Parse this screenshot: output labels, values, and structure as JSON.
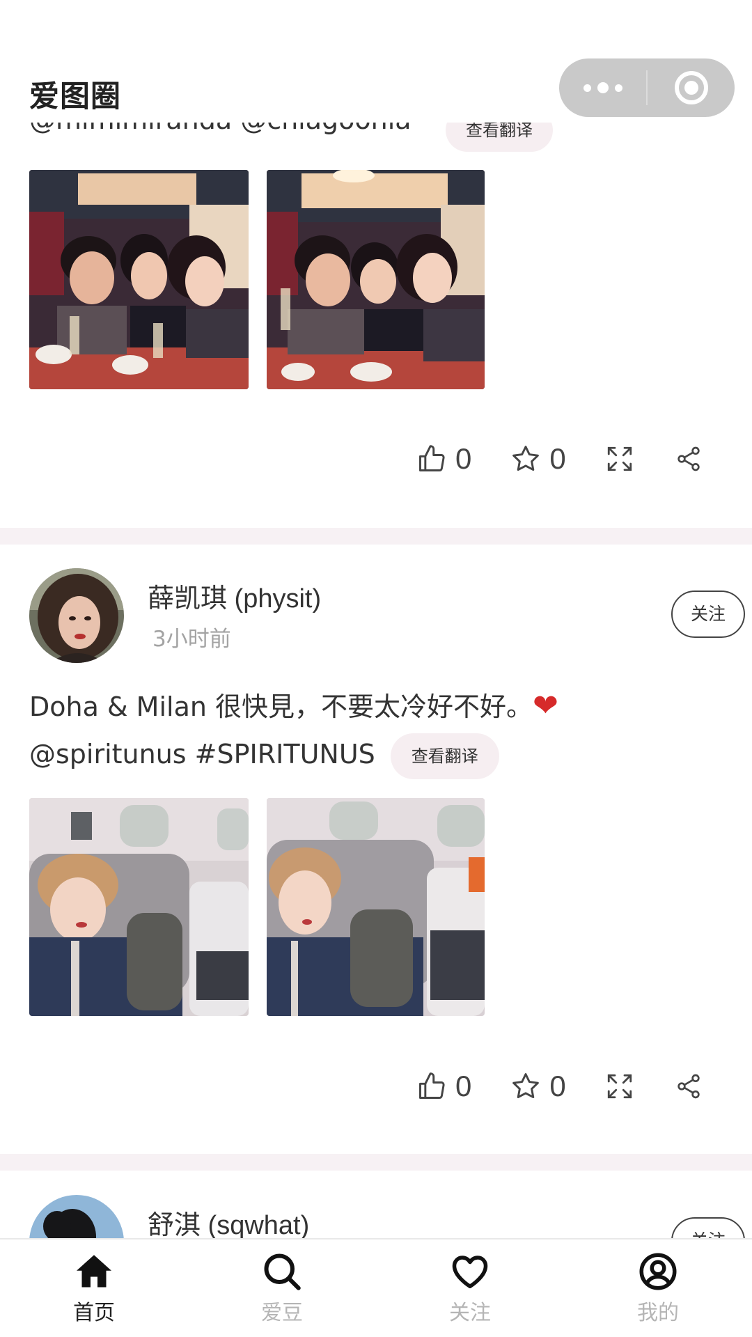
{
  "header": {
    "title": "爱图圈"
  },
  "capsule": {
    "more_icon": "more-dots-icon",
    "close_icon": "target-icon"
  },
  "top_post": {
    "caption_cut": "@mimimiranda @chiagoonla",
    "translate_label": "查看翻译",
    "likes": "0",
    "favorites": "0"
  },
  "post2": {
    "username": "薛凯琪 (physit)",
    "time": "3小时前",
    "follow_label": "关注",
    "text_line1": "Doha & Milan 很快見，不要太冷好不好。",
    "emoji": "❤",
    "text_line2": "@spiritunus #SPIRITUNUS",
    "translate_label": "查看翻译",
    "likes": "0",
    "favorites": "0"
  },
  "post3": {
    "username": "舒淇 (sqwhat)",
    "follow_label": "关注"
  },
  "tabbar": {
    "items": [
      {
        "label": "首页",
        "icon": "home-icon",
        "active": true
      },
      {
        "label": "爱豆",
        "icon": "search-icon",
        "active": false
      },
      {
        "label": "关注",
        "icon": "heart-icon",
        "active": false
      },
      {
        "label": "我的",
        "icon": "profile-icon",
        "active": false
      }
    ]
  },
  "colors": {
    "accent_text": "#222222",
    "inactive_tab": "#b5b5b5",
    "pill_bg": "#f6eef1",
    "separator": "#f7f1f4"
  }
}
